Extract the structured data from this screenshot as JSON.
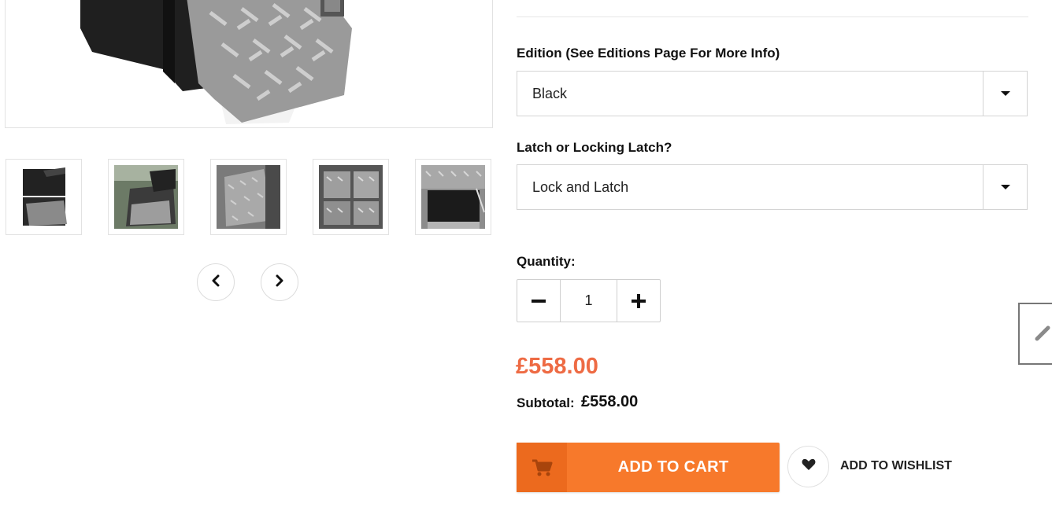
{
  "gallery": {
    "main_image": "toolbox-product-photo",
    "thumbnails": [
      {
        "name": "thumb-black-drawers"
      },
      {
        "name": "thumb-open-lid"
      },
      {
        "name": "thumb-side-view"
      },
      {
        "name": "thumb-chequer-front"
      },
      {
        "name": "thumb-open-box"
      }
    ],
    "prev_icon": "chevron-left-icon",
    "next_icon": "chevron-right-icon"
  },
  "options": {
    "edition": {
      "label": "Edition (See Editions Page For More Info)",
      "selected": "Black"
    },
    "latch": {
      "label": "Latch or Locking Latch?",
      "selected": "Lock and Latch"
    }
  },
  "quantity": {
    "label": "Quantity:",
    "value": "1"
  },
  "pricing": {
    "price": "£558.00",
    "subtotal_label": "Subtotal:",
    "subtotal_value": "£558.00"
  },
  "actions": {
    "add_to_cart": "ADD TO CART",
    "add_to_wishlist": "ADD TO WISHLIST"
  },
  "colors": {
    "accent_orange": "#f7792b",
    "price_color": "#ee6b44"
  }
}
